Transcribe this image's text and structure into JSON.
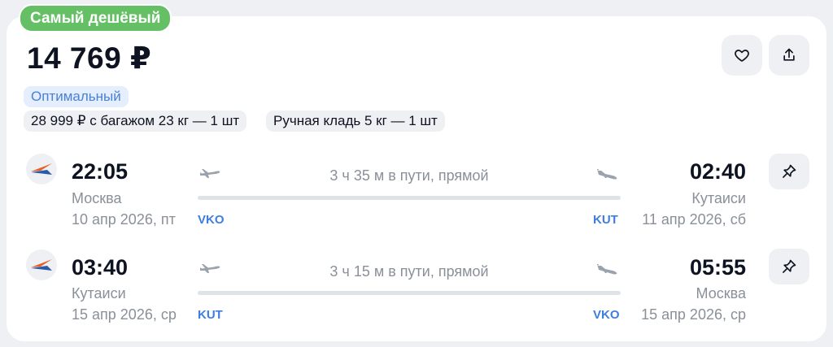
{
  "badge": "Самый дешёвый",
  "price": "14 769 ₽",
  "tariff": "Оптимальный",
  "options": {
    "baggage": "28 999 ₽ с багажом 23 кг — 1 шт",
    "hand_luggage": "Ручная кладь 5 кг — 1 шт"
  },
  "flights": [
    {
      "dep_time": "22:05",
      "dep_city": "Москва",
      "dep_date": "10 апр 2026, пт",
      "dep_code": "VKO",
      "duration": "3 ч 35 м в пути, прямой",
      "arr_time": "02:40",
      "arr_city": "Кутаиси",
      "arr_date": "11 апр 2026, сб",
      "arr_code": "KUT"
    },
    {
      "dep_time": "03:40",
      "dep_city": "Кутаиси",
      "dep_date": "15 апр 2026, ср",
      "dep_code": "KUT",
      "duration": "3 ч 15 м в пути, прямой",
      "arr_time": "05:55",
      "arr_city": "Москва",
      "arr_date": "15 апр 2026, ср",
      "arr_code": "VKO"
    }
  ],
  "icons": {
    "favorite": "heart-icon",
    "share": "share-icon",
    "pin": "pin-icon",
    "airline": "airline-logo",
    "takeoff": "plane-takeoff-icon",
    "landing": "plane-landing-icon"
  },
  "colors": {
    "badge": "#65bf65",
    "accent": "#3d7ee0",
    "tariff_bg": "#e4eefc"
  }
}
